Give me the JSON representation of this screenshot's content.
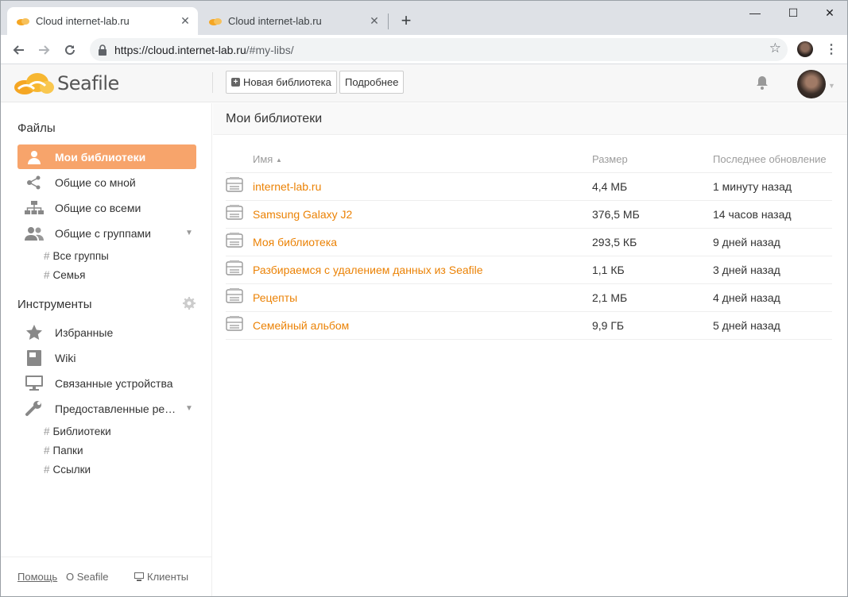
{
  "browser": {
    "tabs": [
      {
        "title": "Cloud internet-lab.ru",
        "active": true
      },
      {
        "title": "Cloud internet-lab.ru",
        "active": false
      }
    ],
    "new_tab": "+",
    "window_controls": {
      "minimize": "—",
      "maximize": "☐",
      "close": "✕"
    },
    "url_host": "https://cloud.internet-lab.ru",
    "url_path": "/#my-libs/"
  },
  "header": {
    "logo_text": "Seafile",
    "new_library_label": "Новая библиотека",
    "details_label": "Подробнее"
  },
  "sidebar": {
    "files_heading": "Файлы",
    "items": [
      {
        "label": "Мои библиотеки",
        "icon": "user-icon",
        "active": true
      },
      {
        "label": "Общие со мной",
        "icon": "share-icon"
      },
      {
        "label": "Общие со всеми",
        "icon": "org-tree-icon"
      },
      {
        "label": "Общие с группами",
        "icon": "group-icon"
      }
    ],
    "groups": [
      {
        "label": "Все группы"
      },
      {
        "label": "Семья"
      }
    ],
    "tools_heading": "Инструменты",
    "tools": [
      {
        "label": "Избранные",
        "icon": "star-icon"
      },
      {
        "label": "Wiki",
        "icon": "book-icon"
      },
      {
        "label": "Связанные устройства",
        "icon": "monitor-icon"
      },
      {
        "label": "Предоставленные ре…",
        "icon": "wrench-icon"
      }
    ],
    "shared_links": [
      {
        "label": "Библиотеки"
      },
      {
        "label": "Папки"
      },
      {
        "label": "Ссылки"
      }
    ],
    "footer": {
      "help": "Помощь",
      "about": "О Seafile",
      "clients": "Клиенты"
    }
  },
  "main": {
    "title": "Мои библиотеки",
    "columns": {
      "name": "Имя",
      "size": "Размер",
      "updated": "Последнее обновление"
    },
    "libraries": [
      {
        "name": "internet-lab.ru",
        "size": "4,4 МБ",
        "updated": "1 минуту назад"
      },
      {
        "name": "Samsung Galaxy J2",
        "size": "376,5 МБ",
        "updated": "14 часов назад"
      },
      {
        "name": "Моя библиотека",
        "size": "293,5 КБ",
        "updated": "9 дней назад"
      },
      {
        "name": "Разбираемся с удалением данных из Seafile",
        "size": "1,1 КБ",
        "updated": "3 дней назад"
      },
      {
        "name": "Рецепты",
        "size": "2,1 МБ",
        "updated": "4 дней назад"
      },
      {
        "name": "Семейный альбом",
        "size": "9,9 ГБ",
        "updated": "5 дней назад"
      }
    ]
  },
  "colors": {
    "accent": "#f7a46b",
    "link": "#eb8205"
  }
}
